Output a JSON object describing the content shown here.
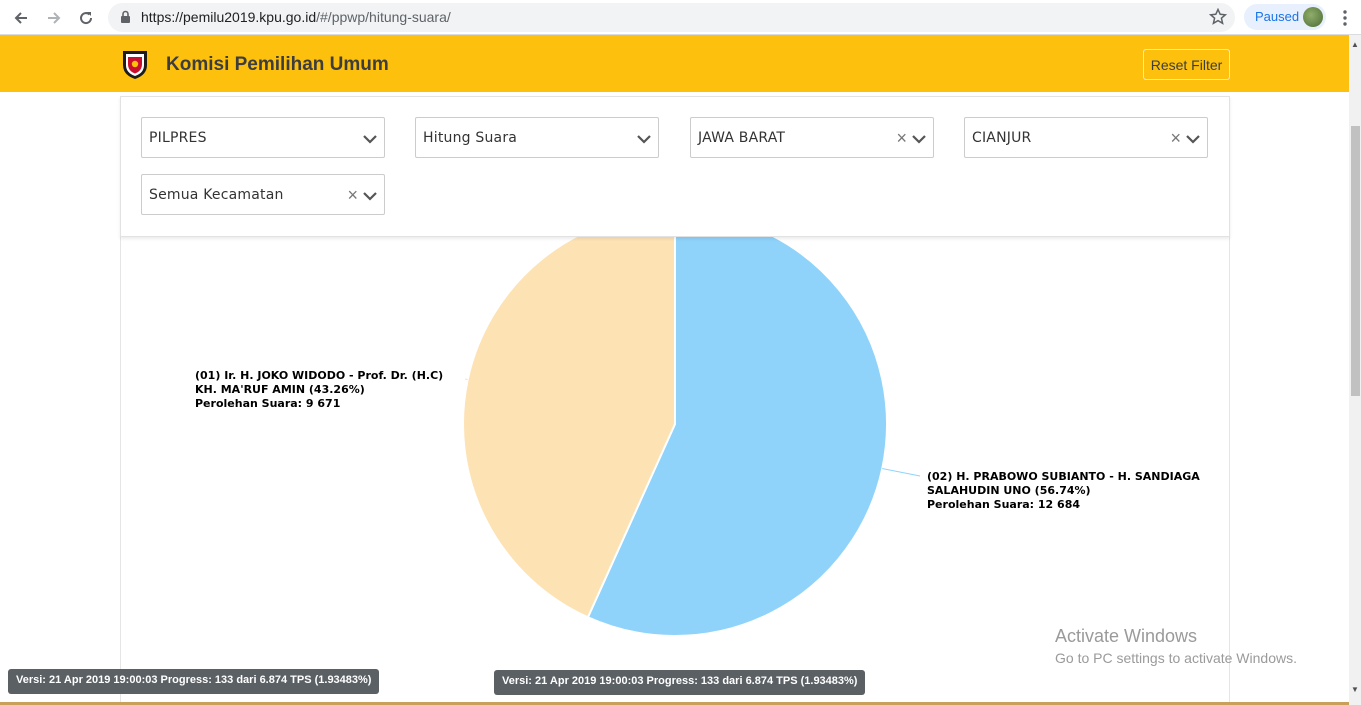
{
  "browser": {
    "url_host": "https://pemilu2019.kpu.go.id",
    "url_path": "/#/ppwp/hitung-suara/",
    "profile_status": "Paused"
  },
  "header": {
    "title": "Komisi Pemilihan Umum",
    "reset_label": "Reset Filter"
  },
  "filters": {
    "election": "PILPRES",
    "view": "Hitung Suara",
    "province": "JAWA BARAT",
    "regency": "CIANJUR",
    "district": "Semua Kecamatan"
  },
  "chart_data": {
    "type": "pie",
    "slices": [
      {
        "label_line1": "(01) Ir. H. JOKO WIDODO - Prof. Dr. (H.C)",
        "label_line2": "KH. MA'RUF AMIN (43.26%)",
        "votes_label": "Perolehan Suara: 9 671",
        "percent": 43.26,
        "votes": 9671,
        "color": "#fde2b4"
      },
      {
        "label_line1": "(02) H. PRABOWO SUBIANTO - H. SANDIAGA",
        "label_line2": "SALAHUDIN UNO (56.74%)",
        "votes_label": "Perolehan Suara: 12 684",
        "percent": 56.74,
        "votes": 12684,
        "color": "#8fd3fb"
      }
    ]
  },
  "footer": {
    "version_left": "Versi: 21 Apr 2019 19:00:03 Progress: 133 dari 6.874 TPS (1.93483%)",
    "version_center": "Versi: 21 Apr 2019 19:00:03 Progress: 133 dari 6.874 TPS (1.93483%)"
  },
  "watermark": {
    "title": "Activate Windows",
    "subtitle": "Go to PC settings to activate Windows."
  }
}
